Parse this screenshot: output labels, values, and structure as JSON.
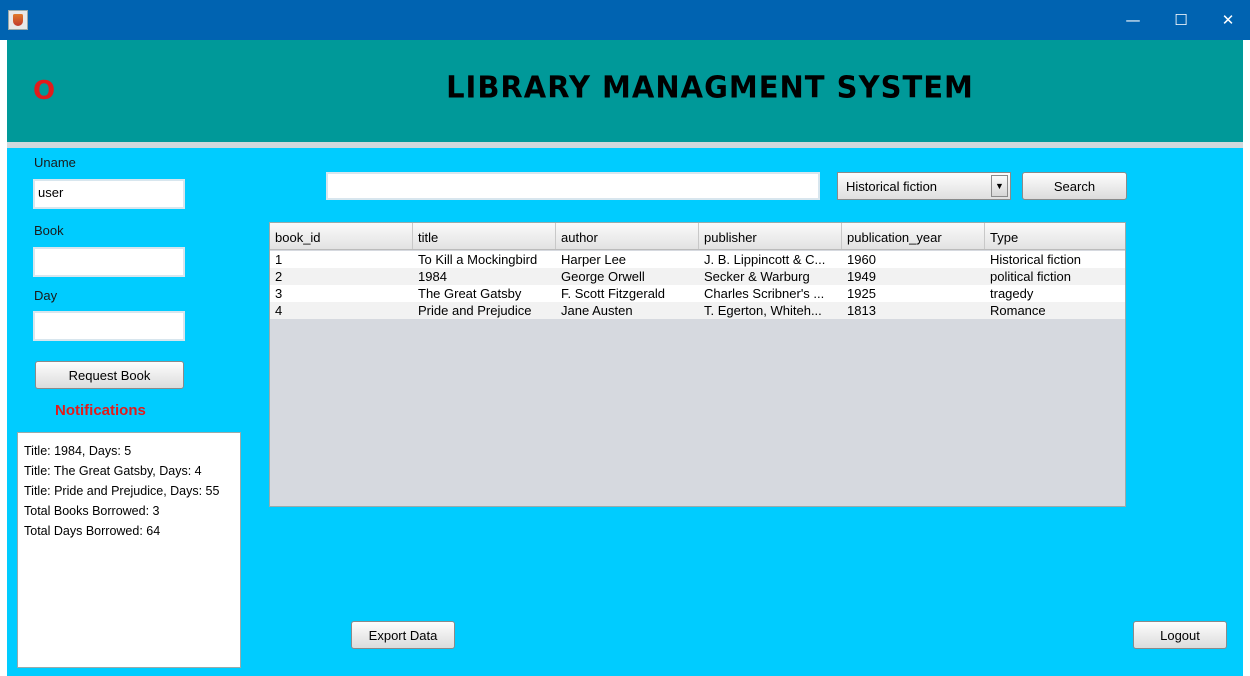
{
  "window": {
    "minimize_glyph": "—",
    "maximize_glyph": "☐",
    "close_glyph": "✕"
  },
  "header": {
    "logo_text": "O",
    "title": "LIBRARY MANAGMENT SYSTEM"
  },
  "sidebar": {
    "uname_label": "Uname",
    "uname_value": "user",
    "book_label": "Book",
    "book_value": "",
    "day_label": "Day",
    "day_value": "",
    "request_button": "Request Book",
    "notifications_title": "Notifications",
    "notifications": [
      "Title: 1984, Days: 5",
      "Title: The Great Gatsby, Days: 4",
      "Title: Pride and Prejudice, Days: 55",
      "Total Books Borrowed: 3",
      "Total Days Borrowed: 64"
    ]
  },
  "search": {
    "query": "",
    "type_selected": "Historical fiction",
    "button": "Search"
  },
  "table": {
    "columns": [
      "book_id",
      "title",
      "author",
      "publisher",
      "publication_year",
      "Type"
    ],
    "rows": [
      [
        "1",
        "To Kill a Mockingbird",
        "Harper Lee",
        "J. B. Lippincott & C...",
        "1960",
        "Historical fiction"
      ],
      [
        "2",
        "1984",
        "George Orwell",
        "Secker & Warburg",
        "1949",
        "political fiction"
      ],
      [
        "3",
        "The Great Gatsby",
        "F. Scott Fitzgerald",
        "Charles Scribner's ...",
        "1925",
        "tragedy"
      ],
      [
        "4",
        "Pride and Prejudice",
        "Jane Austen",
        "T. Egerton, Whiteh...",
        "1813",
        "Romance"
      ]
    ]
  },
  "footer": {
    "export_button": "Export Data",
    "logout_button": "Logout"
  },
  "colors": {
    "titlebar": "#0063b1",
    "header": "#009999",
    "main": "#00ccff",
    "notifications_title": "#e21b1b"
  }
}
